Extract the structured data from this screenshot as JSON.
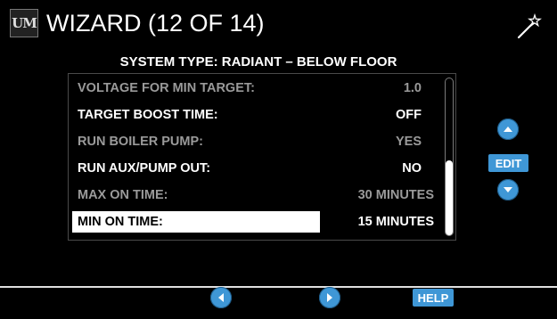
{
  "header": {
    "logo_text": "UM",
    "title": "WIZARD (12 OF 14)",
    "wand_icon": "magic-wand-icon"
  },
  "subtitle": "SYSTEM TYPE: RADIANT – BELOW FLOOR",
  "settings": [
    {
      "label": "VOLTAGE FOR MIN TARGET:",
      "value": "1.0",
      "state": "disabled"
    },
    {
      "label": "TARGET BOOST TIME:",
      "value": "OFF",
      "state": "enabled"
    },
    {
      "label": "RUN BOILER PUMP:",
      "value": "YES",
      "state": "disabled"
    },
    {
      "label": "RUN AUX/PUMP OUT:",
      "value": "NO",
      "state": "enabled"
    },
    {
      "label": "MAX ON TIME:",
      "value": "30 MINUTES",
      "state": "disabled"
    },
    {
      "label": "MIN ON TIME:",
      "value": "15 MINUTES",
      "state": "selected"
    }
  ],
  "scroll": {
    "position": 1.0
  },
  "side_controls": {
    "up_icon": "up-arrow-icon",
    "edit_label": "EDIT",
    "down_icon": "down-arrow-icon"
  },
  "footer": {
    "prev_icon": "left-arrow-icon",
    "next_icon": "right-arrow-icon",
    "help_label": "HELP"
  },
  "colors": {
    "background": "#000000",
    "accent": "#3f97d6",
    "disabled_text": "#9a9a9a",
    "text": "#ffffff"
  }
}
